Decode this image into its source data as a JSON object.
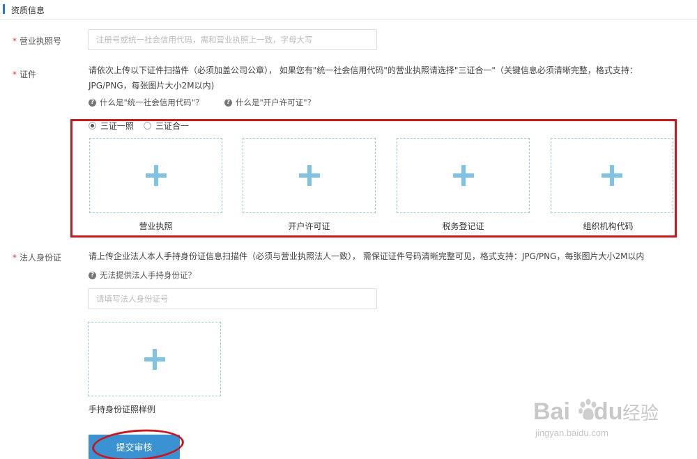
{
  "section": {
    "title": "资质信息"
  },
  "license_no": {
    "required_mark": "*",
    "label": "营业执照号",
    "placeholder": "注册号或统一社会信用代码，需和营业执照上一致，字母大写"
  },
  "certs": {
    "required_mark": "*",
    "label": "证件",
    "desc_line1": "请依次上传以下证件扫描件（必须加盖公司公章）， 如果您有\"统一社会信用代码\"的营业执照请选择\"三证合一\"（关键信息必须清晰完整，格式支持：",
    "desc_line2": "JPG/PNG，每张图片大小2M以内)",
    "help_link_1": "什么是\"统一社会信用代码\"？",
    "help_link_2": "什么是\"开户许可证\"？",
    "options": [
      {
        "label": "三证一照",
        "checked": true
      },
      {
        "label": "三证合一",
        "checked": false
      }
    ],
    "uploads": [
      {
        "caption": "营业执照"
      },
      {
        "caption": "开户许可证"
      },
      {
        "caption": "税务登记证"
      },
      {
        "caption": "组织机构代码"
      }
    ]
  },
  "legal_id": {
    "required_mark": "*",
    "label": "法人身份证",
    "desc": "请上传企业法人本人手持身份证信息扫描件（必须与营业执照法人一致）， 需保证证件号码清晰完整可见，格式支持：JPG/PNG，每张图片大小2M以内",
    "help_link": "无法提供法人手持身份证？",
    "placeholder": "请填写法人身份证号",
    "upload_caption": "手持身份证照样例"
  },
  "submit": {
    "label": "提交审核"
  },
  "watermark": {
    "brand": "Bai",
    "brand_suffix": "du",
    "cn": "经验",
    "url": "jingyan.baidu.com"
  },
  "colors": {
    "accent": "#3a92d2",
    "highlight": "#c8181e",
    "required": "#e4393c",
    "plus": "#7fc2e4"
  }
}
